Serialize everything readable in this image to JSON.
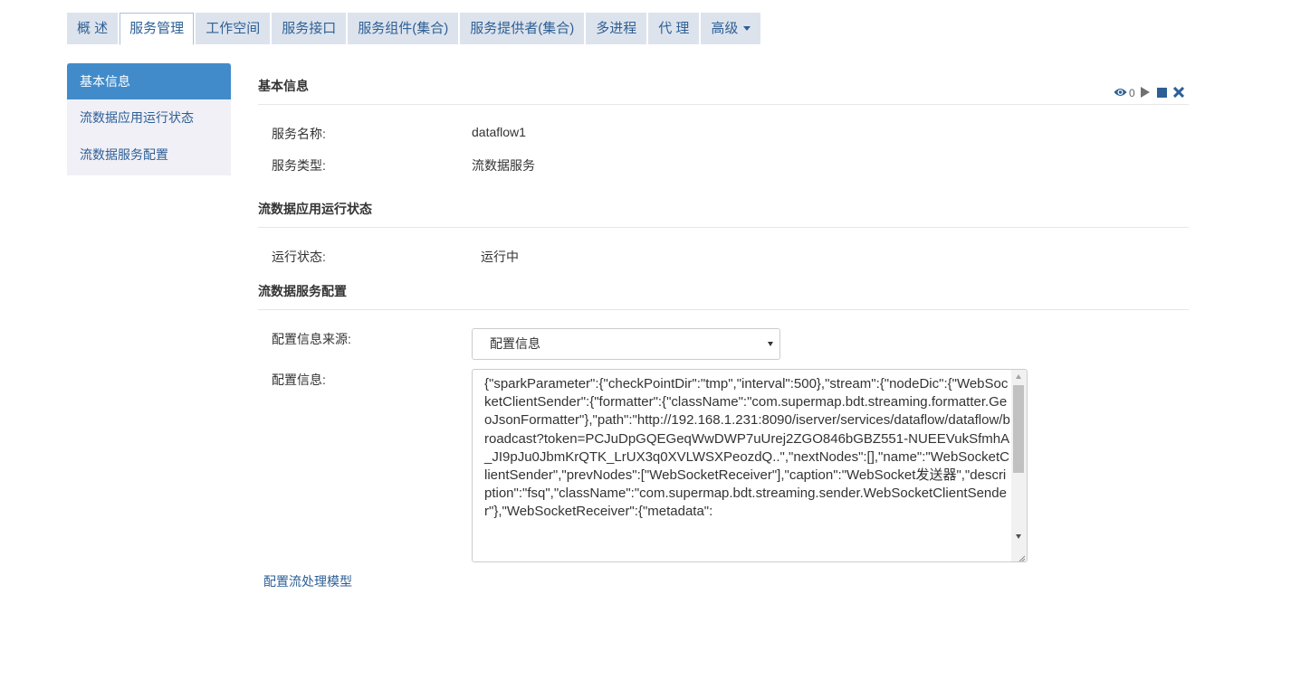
{
  "tabs": [
    {
      "label": "概 述",
      "active": false
    },
    {
      "label": "服务管理",
      "active": true
    },
    {
      "label": "工作空间",
      "active": false
    },
    {
      "label": "服务接口",
      "active": false
    },
    {
      "label": "服务组件(集合)",
      "active": false
    },
    {
      "label": "服务提供者(集合)",
      "active": false
    },
    {
      "label": "多进程",
      "active": false
    },
    {
      "label": "代 理",
      "active": false
    },
    {
      "label": "高级",
      "active": false,
      "dropdown": true
    }
  ],
  "sidemenu": [
    {
      "label": "基本信息",
      "active": true
    },
    {
      "label": "流数据应用运行状态",
      "active": false
    },
    {
      "label": "流数据服务配置",
      "active": false
    }
  ],
  "basic": {
    "title": "基本信息",
    "toolbar": {
      "view_icon": "eye-icon",
      "count": "0",
      "play_icon": "play-icon",
      "stop_icon": "stop-icon",
      "close_icon": "close-icon"
    },
    "name_label": "服务名称:",
    "name_value": "dataflow1",
    "type_label": "服务类型:",
    "type_value": "流数据服务"
  },
  "status": {
    "title": "流数据应用运行状态",
    "state_label": "运行状态:",
    "state_value": "运行中"
  },
  "config": {
    "title": "流数据服务配置",
    "source_label": "配置信息来源:",
    "source_value": "配置信息",
    "info_label": "配置信息:",
    "info_value": "{\"sparkParameter\":{\"checkPointDir\":\"tmp\",\"interval\":500},\"stream\":{\"nodeDic\":{\"WebSocketClientSender\":{\"formatter\":{\"className\":\"com.supermap.bdt.streaming.formatter.GeoJsonFormatter\"},\"path\":\"http://192.168.1.231:8090/iserver/services/dataflow/dataflow/broadcast?token=PCJuDpGQEGeqWwDWP7uUrej2ZGO846bGBZ551-NUEEVukSfmhA_JI9pJu0JbmKrQTK_LrUX3q0XVLWSXPeozdQ..\",\"nextNodes\":[],\"name\":\"WebSocketClientSender\",\"prevNodes\":[\"WebSocketReceiver\"],\"caption\":\"WebSocket发送器\",\"description\":\"fsq\",\"className\":\"com.supermap.bdt.streaming.sender.WebSocketClientSender\"},\"WebSocketReceiver\":{\"metadata\":",
    "link_label": "配置流处理模型"
  },
  "colors": {
    "accent": "#428bca",
    "link": "#2d5f96",
    "tab_bg": "#dde3ec",
    "side_bg": "#f1f0f6"
  }
}
